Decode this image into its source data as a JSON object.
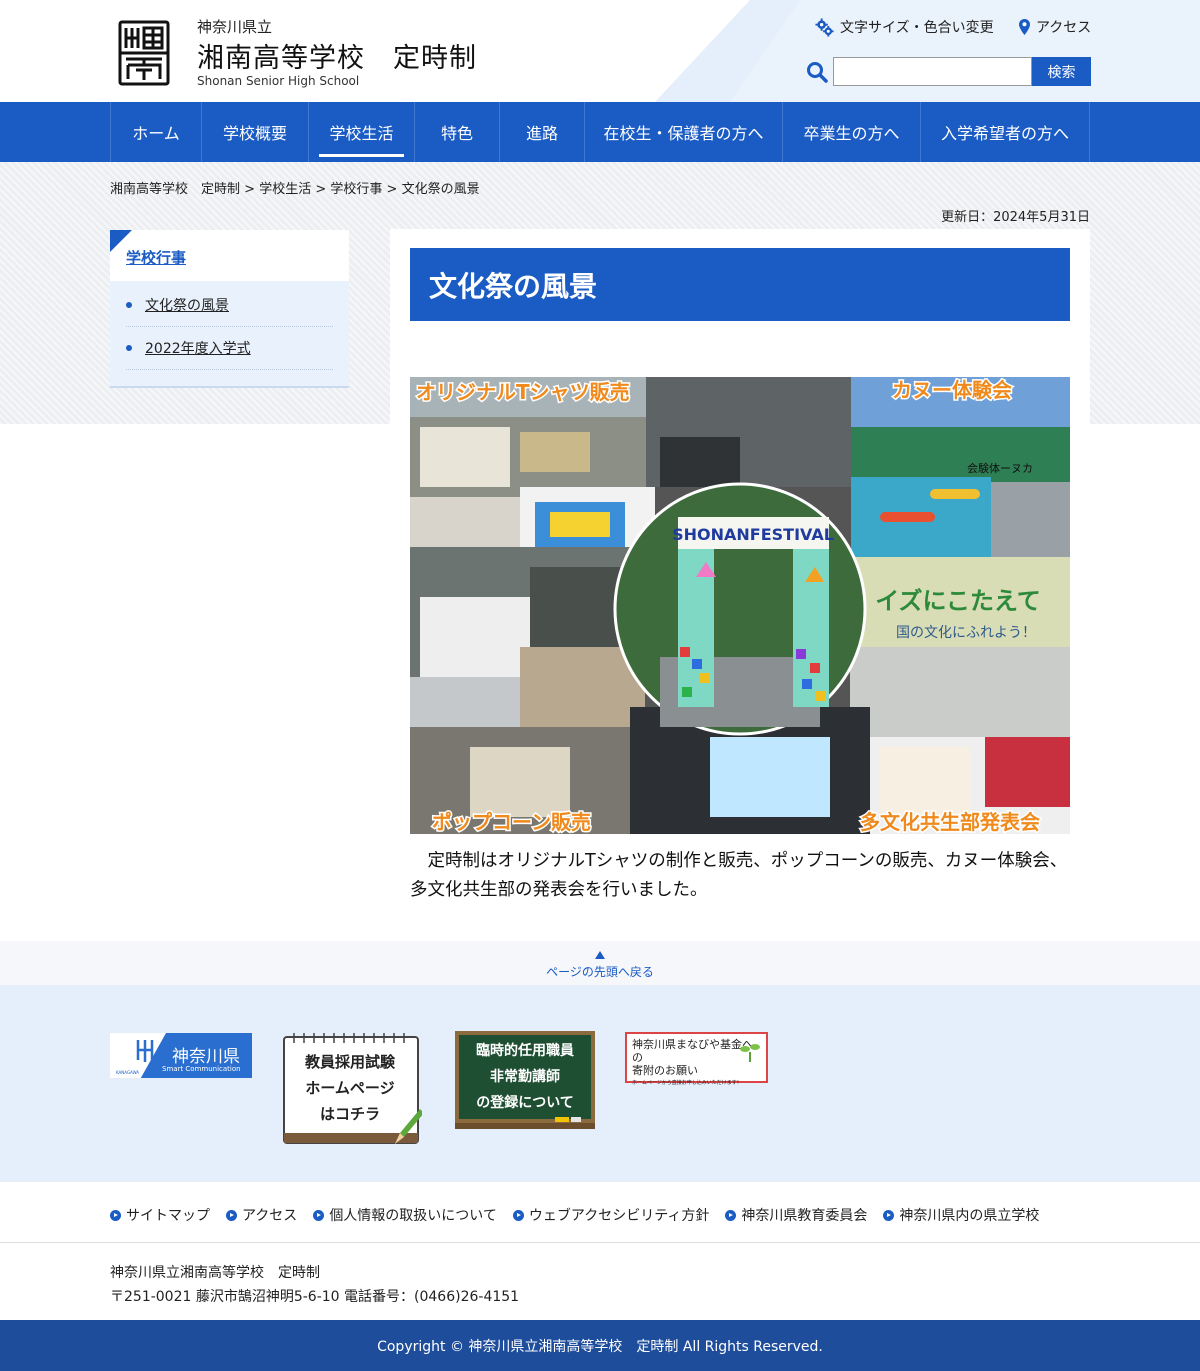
{
  "header": {
    "prefecture": "神奈川県立",
    "school_name": "湘南高等学校　定時制",
    "school_name_en": "Shonan Senior High School",
    "utility": {
      "font_size_color": "文字サイズ・色合い変更",
      "access": "アクセス"
    },
    "search": {
      "placeholder": "",
      "button": "検索"
    }
  },
  "nav": {
    "items": [
      {
        "label": "ホーム"
      },
      {
        "label": "学校概要"
      },
      {
        "label": "学校生活"
      },
      {
        "label": "特色"
      },
      {
        "label": "進路"
      },
      {
        "label": "在校生・保護者の方へ"
      },
      {
        "label": "卒業生の方へ"
      },
      {
        "label": "入学希望者の方へ"
      }
    ],
    "active_index": 2
  },
  "breadcrumb": {
    "items": [
      "湘南高等学校　定時制",
      "学校生活",
      "学校行事",
      "文化祭の風景"
    ],
    "separator": " > "
  },
  "updated": "更新日：2024年5月31日",
  "sidenav": {
    "title": "学校行事",
    "items": [
      {
        "label": "文化祭の風景"
      },
      {
        "label": "2022年度入学式"
      }
    ]
  },
  "main": {
    "title": "文化祭の風景",
    "collage": {
      "labels": {
        "tshirt": "オリジナルTシャツ販売",
        "canoe": "カヌー体験会",
        "popcorn": "ポップコーン販売",
        "multicultural": "多文化共生部発表会",
        "festival_sign": "SHONANFESTIVAL",
        "quiz": "イズにこたえて",
        "quiz_sub": "国の文化にふれよう！",
        "canoe_banner": "会験体ーヌカ"
      }
    },
    "body": "定時制はオリジナルTシャツの制作と販売、ポップコーンの販売、カヌー体験会、多文化共生部の発表会を行いました。"
  },
  "pagetop": {
    "label": "ページの先頭へ戻る"
  },
  "banners": {
    "pref": {
      "main": "神奈川県",
      "sub": "Smart Communication",
      "tiny": "KANAGAWA"
    },
    "teacher": {
      "lines": [
        "教員採用試験",
        "ホームページ",
        "はコチラ"
      ]
    },
    "board": {
      "lines": [
        "臨時的任用職員",
        "非常勤講師",
        "の登録について"
      ]
    },
    "fund": {
      "line1": "神奈川県まなびや基金への",
      "line2": "寄附のお願い",
      "line3": "ホームページから直接お申し込みいただけます！"
    }
  },
  "footer": {
    "links": [
      {
        "label": "サイトマップ"
      },
      {
        "label": "アクセス"
      },
      {
        "label": "個人情報の取扱いについて"
      },
      {
        "label": "ウェブアクセシビリティ方針"
      },
      {
        "label": "神奈川県教育委員会"
      },
      {
        "label": "神奈川県内の県立学校"
      }
    ],
    "address_line1": "神奈川県立湘南高等学校　定時制",
    "address_line2": "〒251-0021 藤沢市鵠沼神明5-6-10 電話番号：(0466)26-4151",
    "copyright": "Copyright © 神奈川県立湘南高等学校　定時制 All Rights Reserved."
  },
  "colors": {
    "primary": "#1a5bc4",
    "accent_orange": "#f08a1c",
    "footer_bar": "#1e4d9c"
  }
}
